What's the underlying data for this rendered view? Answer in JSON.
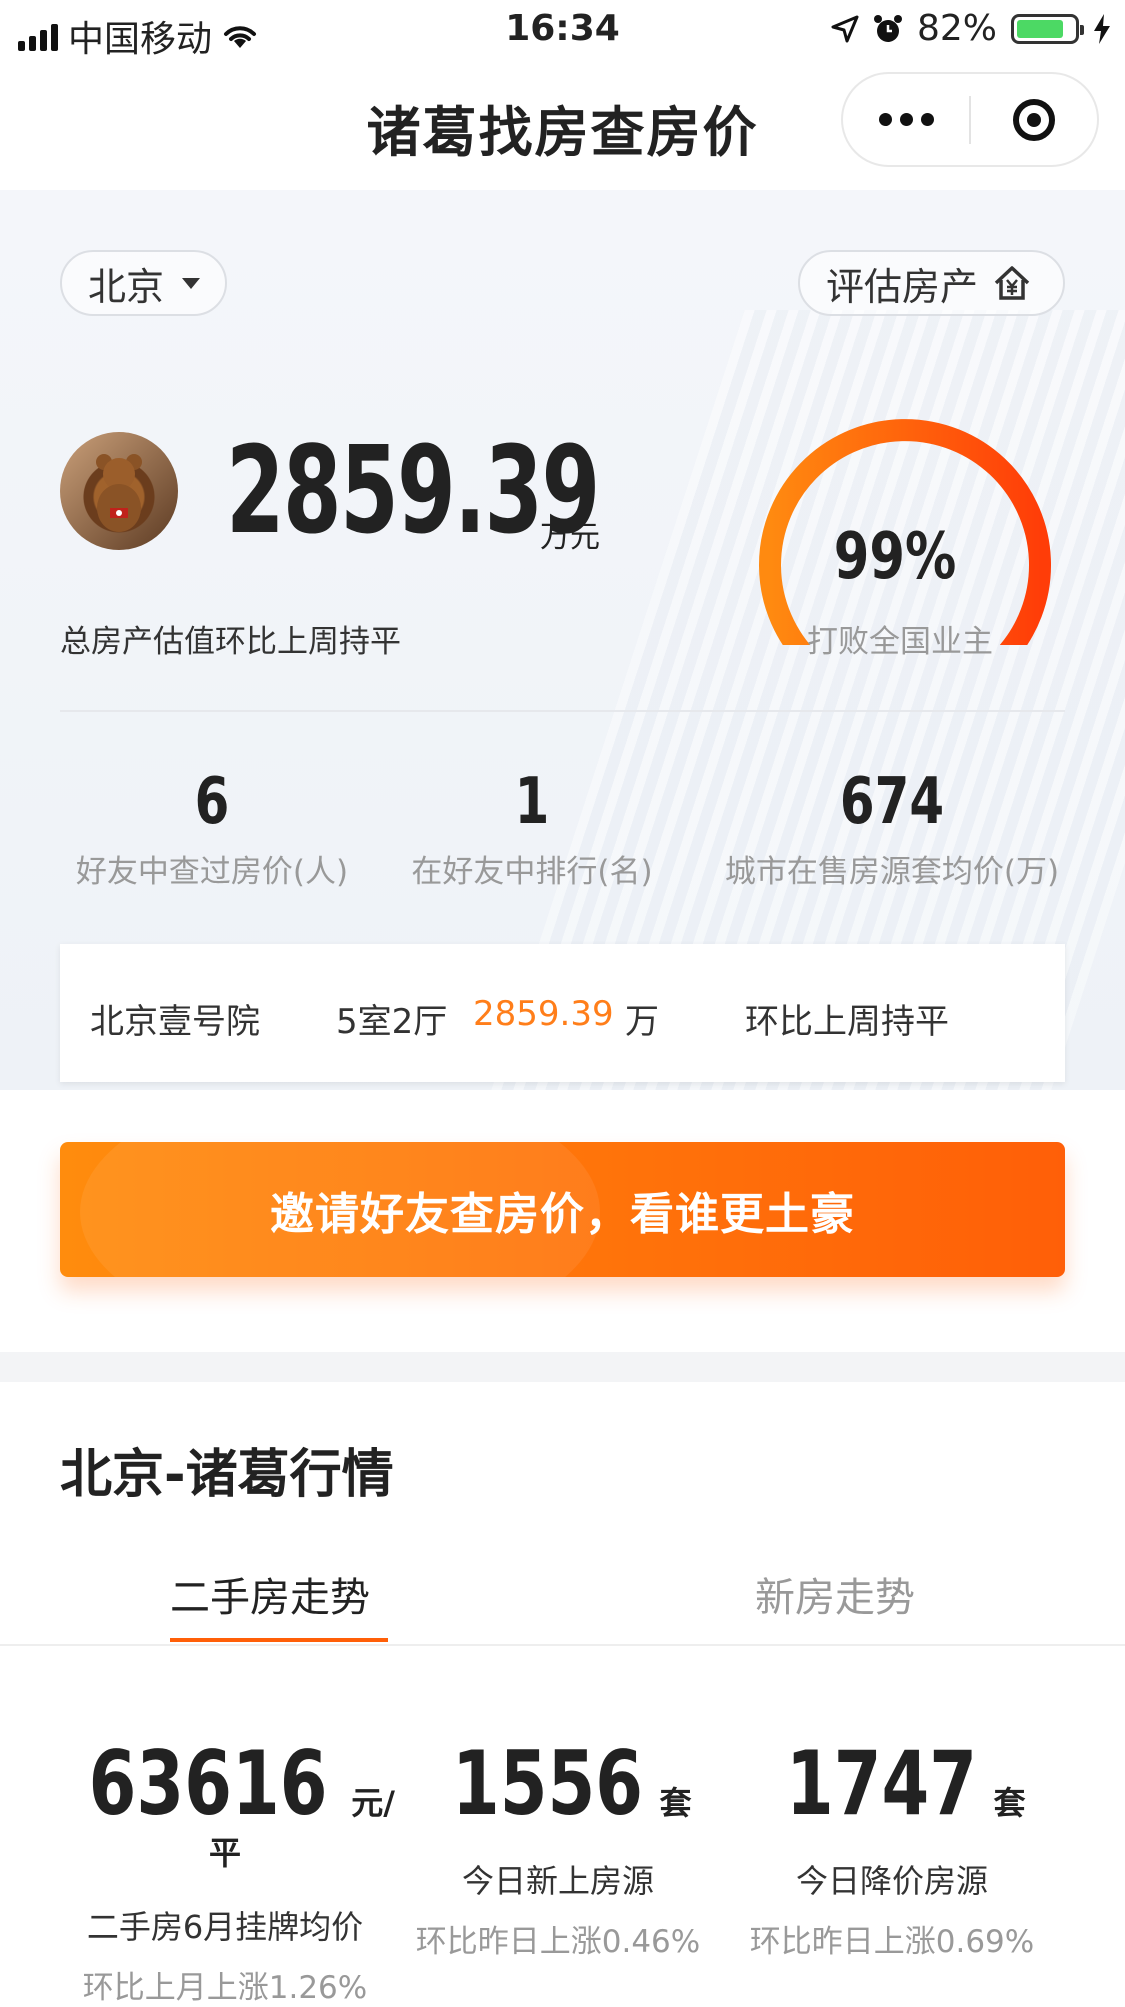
{
  "status_bar": {
    "carrier": "中国移动",
    "time": "16:34",
    "battery": "82%",
    "battery_level": 0.82
  },
  "title_bar": {
    "title": "诸葛找房查房价"
  },
  "hero": {
    "city": "北京",
    "evaluate_label": "评估房产",
    "total_value": "2859.39",
    "total_unit": "万元",
    "compare_text": "总房产估值环比上周持平",
    "rank_percent": "99%",
    "rank_fraction": 0.99,
    "rank_label": "打败全国业主",
    "stats": [
      {
        "value": "6",
        "label": "好友中查过房价(人)"
      },
      {
        "value": "1",
        "label": "在好友中排行(名)"
      },
      {
        "value": "674",
        "label": "城市在售房源套均价(万)"
      }
    ],
    "property": {
      "name": "北京壹号院",
      "layout": "5室2厅",
      "price": "2859.39",
      "price_unit": "万",
      "change": "环比上周持平"
    }
  },
  "cta": {
    "label": "邀请好友查房价，看谁更土豪"
  },
  "colors": {
    "accent": "#ff5f08",
    "accent_light": "#ff8c0d",
    "price": "#ff7e1a"
  },
  "market": {
    "title": "北京-诸葛行情",
    "tabs": [
      {
        "label": "二手房走势",
        "active": true
      },
      {
        "label": "新房走势",
        "active": false
      }
    ],
    "stats": [
      {
        "value": "63616",
        "unit": "元/平",
        "label": "二手房6月挂牌均价",
        "change": "环比上月上涨1.26%"
      },
      {
        "value": "1556",
        "unit": "套",
        "label": "今日新上房源",
        "change": "环比昨日上涨0.46%"
      },
      {
        "value": "1747",
        "unit": "套",
        "label": "今日降价房源",
        "change": "环比昨日上涨0.69%"
      }
    ]
  }
}
